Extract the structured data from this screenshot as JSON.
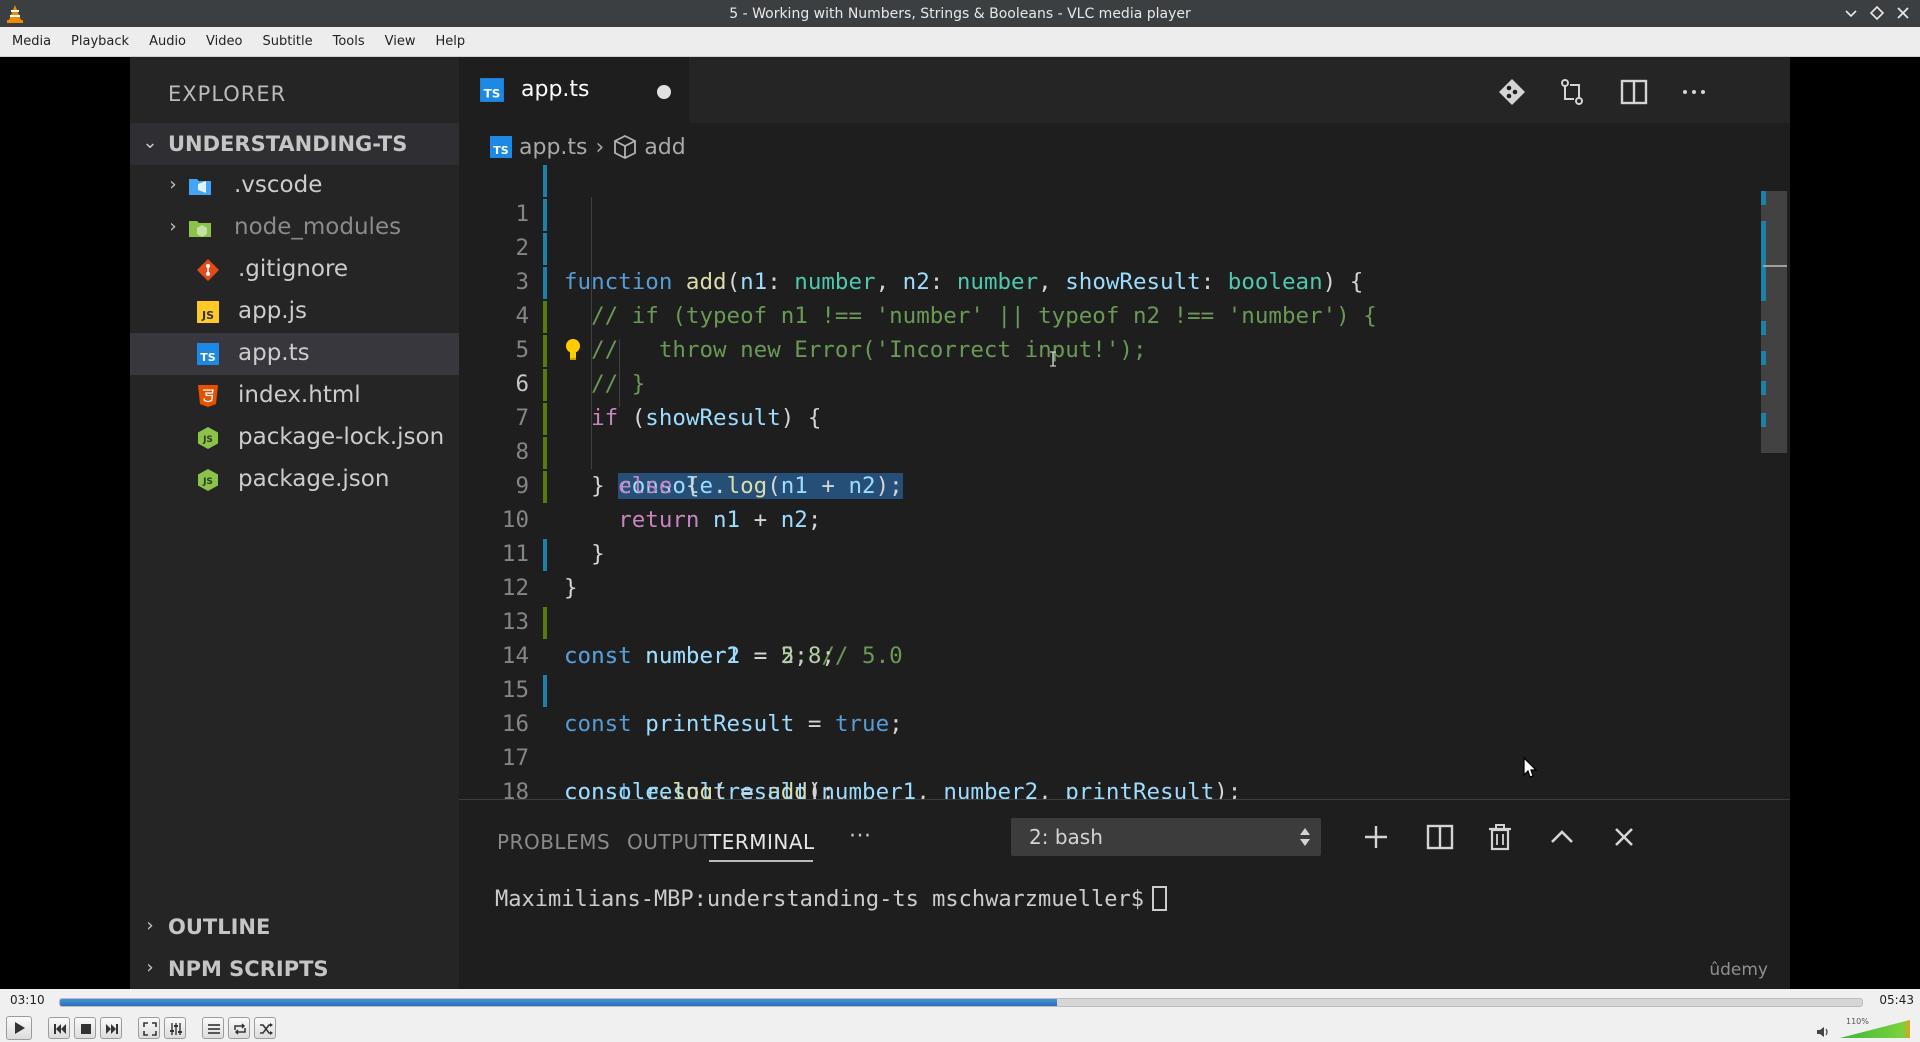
{
  "window": {
    "title": "5 - Working with Numbers, Strings & Booleans - VLC media player"
  },
  "menu": [
    "Media",
    "Playback",
    "Audio",
    "Video",
    "Subtitle",
    "Tools",
    "View",
    "Help"
  ],
  "vscode": {
    "explorer_title": "EXPLORER",
    "project": "UNDERSTANDING-TS",
    "files": [
      {
        "name": ".vscode",
        "kind": "folder"
      },
      {
        "name": "node_modules",
        "kind": "folder"
      },
      {
        "name": ".gitignore",
        "kind": "git"
      },
      {
        "name": "app.js",
        "kind": "js"
      },
      {
        "name": "app.ts",
        "kind": "ts",
        "active": true
      },
      {
        "name": "index.html",
        "kind": "html"
      },
      {
        "name": "package-lock.json",
        "kind": "json"
      },
      {
        "name": "package.json",
        "kind": "json"
      }
    ],
    "sections": [
      "OUTLINE",
      "NPM SCRIPTS"
    ],
    "tab_label": "app.ts",
    "breadcrumb": {
      "file": "app.ts",
      "symbol": "add"
    },
    "line_numbers": [
      "1",
      "2",
      "3",
      "4",
      "5",
      "6",
      "7",
      "8",
      "9",
      "10",
      "11",
      "12",
      "13",
      "14",
      "15",
      "16",
      "17",
      "18"
    ],
    "panel_tabs": [
      "PROBLEMS",
      "OUTPUT",
      "TERMINAL"
    ],
    "panel_more": "···",
    "terminal_select": "2: bash",
    "terminal_prompt": "Maximilians-MBP:understanding-ts mschwarzmueller$",
    "watermark": "ûdemy"
  },
  "player": {
    "time_current": "03:10",
    "time_total": "05:43",
    "progress": 0.553,
    "volume_label": "110%"
  }
}
